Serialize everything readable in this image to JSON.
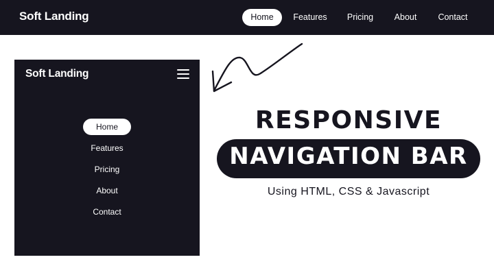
{
  "desktop_nav": {
    "logo": "Soft Landing",
    "links": [
      "Home",
      "Features",
      "Pricing",
      "About",
      "Contact"
    ],
    "active": "Home"
  },
  "mobile_nav": {
    "logo": "Soft Landing",
    "menu_icon": "hamburger-icon",
    "links": [
      "Home",
      "Features",
      "Pricing",
      "About",
      "Contact"
    ],
    "active": "Home"
  },
  "headline": {
    "line1": "RESPONSIVE",
    "line2": "NAVIGATION BAR",
    "subtitle": "Using HTML, CSS & Javascript"
  },
  "colors": {
    "dark": "#16151f",
    "light": "#ffffff"
  }
}
